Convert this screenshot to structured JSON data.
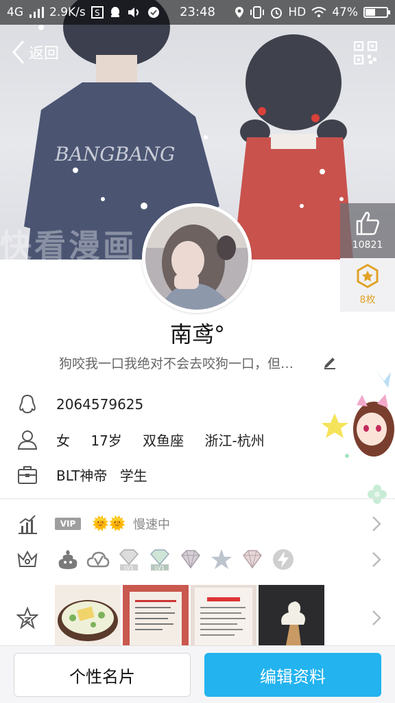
{
  "status_bar": {
    "network": "4G",
    "speed": "2.9K/s",
    "time": "23:48",
    "hd": "HD",
    "battery": "47%",
    "battery_level": 0.47
  },
  "nav": {
    "back_label": "返回"
  },
  "cover": {
    "shirt_text": "BANGBANG",
    "watermark": "快看漫画"
  },
  "likes": {
    "count": "10821"
  },
  "medals": {
    "label": "8枚"
  },
  "profile": {
    "nickname": "南鸢°",
    "signature": "狗咬我一口我绝对不会去咬狗一口，但…"
  },
  "info": {
    "qq_number": "2064579625",
    "gender": "女",
    "age": "17岁",
    "zodiac": "双鱼座",
    "location": "浙江-杭州",
    "school": "BLT神帝",
    "occupation": "学生"
  },
  "level": {
    "vip_badge": "VIP",
    "suns": "🌞🌞",
    "speed_text": "慢速中"
  },
  "badges": {
    "lv_labels": [
      "LV1",
      "LV1"
    ]
  },
  "bottom": {
    "card_button": "个性名片",
    "edit_button": "编辑资料"
  },
  "colors": {
    "accent": "#23b3ef",
    "medal": "#e2a226"
  }
}
